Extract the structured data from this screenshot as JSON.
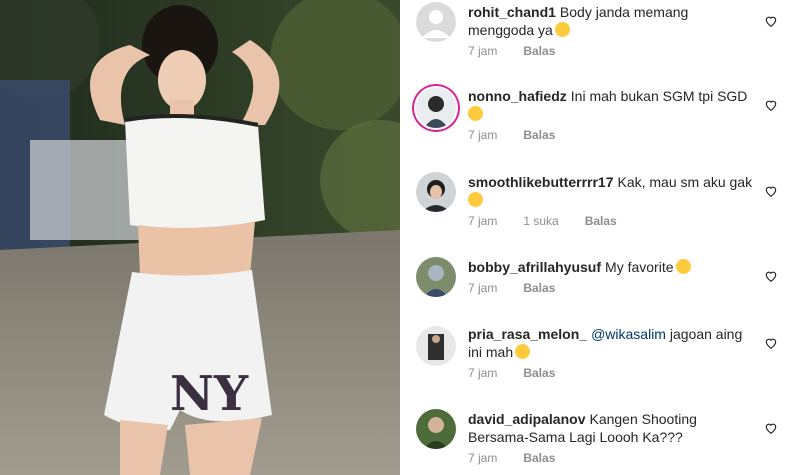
{
  "post_image": {
    "alt_icon": "photo",
    "shirt_print": "NY"
  },
  "comments": [
    {
      "username": "rohit_chand1",
      "text": "Body janda memang menggoda ya",
      "emoji": "grinning-sweat",
      "time": "7 jam",
      "likes": "",
      "reply": "Balas",
      "avatar": "default-avatar-icon"
    },
    {
      "username": "nonno_hafiedz",
      "text": "Ini mah bukan SGM tpi SGD",
      "emoji": "rolling-laugh",
      "time": "7 jam",
      "likes": "",
      "reply": "Balas",
      "avatar": "photo-avatar"
    },
    {
      "username": "smoothlikebutterrrr17",
      "text": "Kak, mau sm aku gak",
      "emoji": "shy-smile",
      "time": "7 jam",
      "likes": "1 suka",
      "reply": "Balas",
      "avatar": "photo-avatar"
    },
    {
      "username": "bobby_afrillahyusuf",
      "text": "My favorite",
      "emoji": "hug-face",
      "time": "7 jam",
      "likes": "",
      "reply": "Balas",
      "avatar": "photo-avatar"
    },
    {
      "username": "pria_rasa_melon_",
      "mention": "@wikasalim",
      "text": "jagoan aing ini mah",
      "emoji": "heart-eyes",
      "time": "7 jam",
      "likes": "",
      "reply": "Balas",
      "avatar": "photo-avatar"
    },
    {
      "username": "david_adipalanov",
      "text": "Kangen Shooting Bersama-Sama Lagi Loooh Ka???",
      "emoji": "",
      "time": "7 jam",
      "likes": "",
      "reply": "Balas",
      "avatar": "photo-avatar"
    }
  ],
  "colors": {
    "meta": "#8e8e8e",
    "text": "#262626",
    "mention": "#00376b",
    "story_ring": "#d6249f"
  }
}
